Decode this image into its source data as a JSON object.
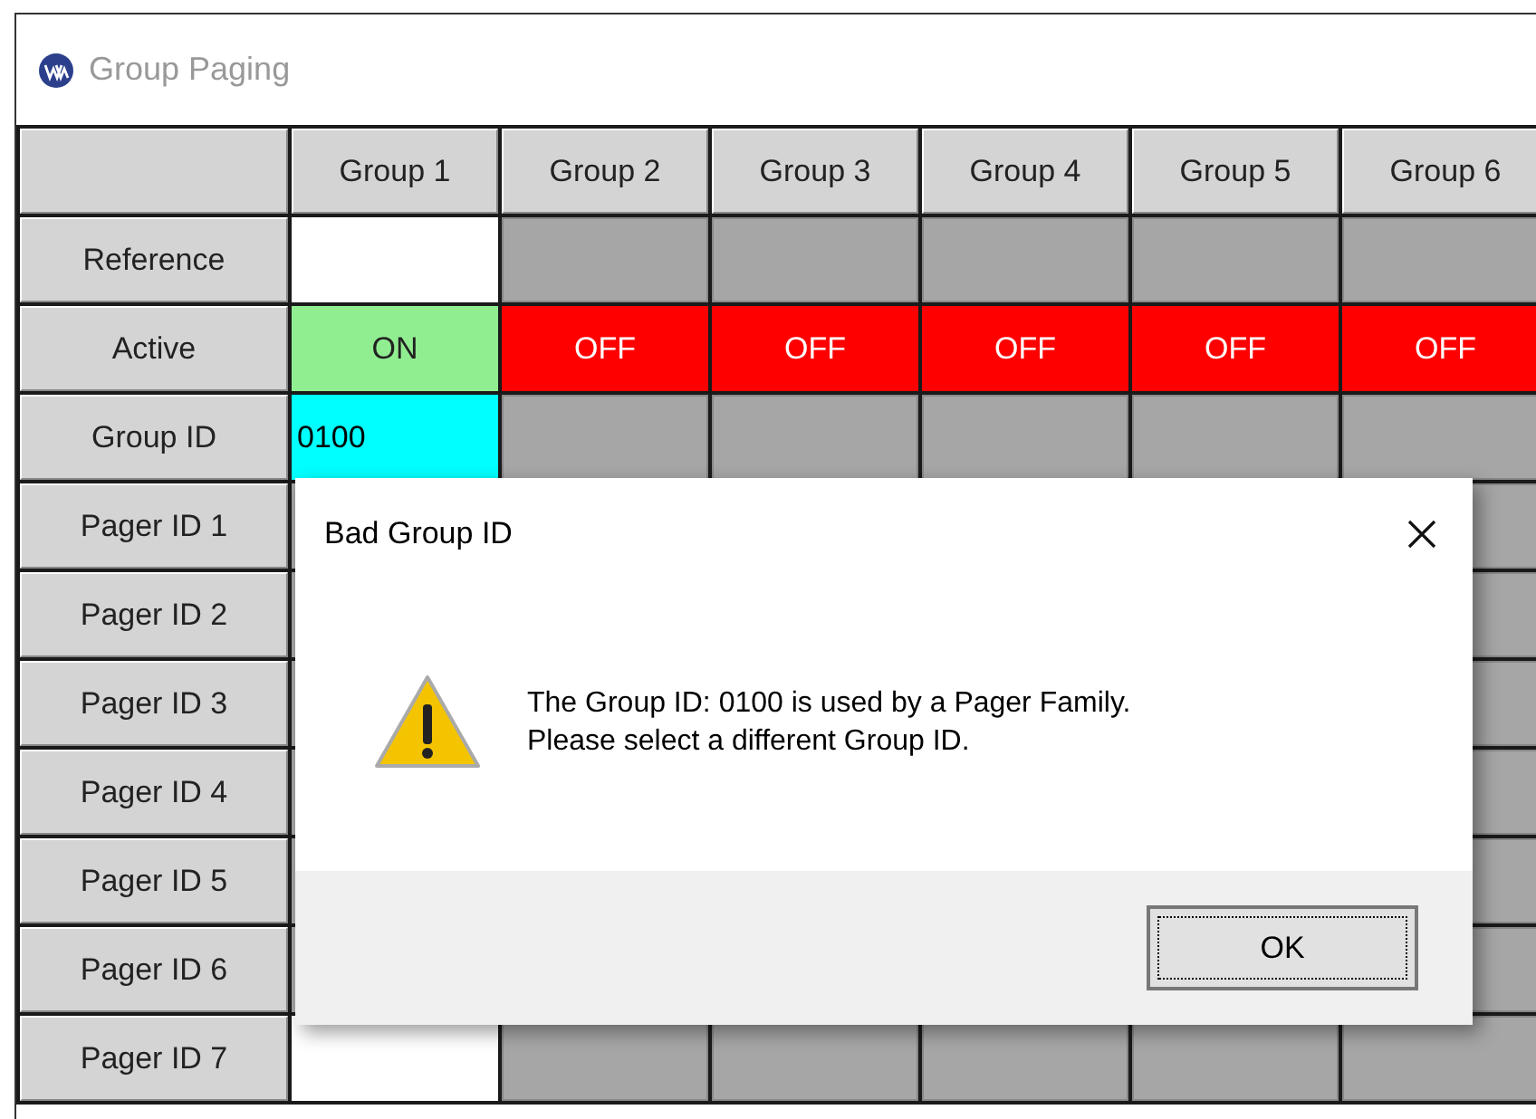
{
  "window": {
    "title": "Group Paging"
  },
  "columns": [
    "Group 1",
    "Group 2",
    "Group 3",
    "Group 4",
    "Group 5",
    "Group 6"
  ],
  "rows": [
    {
      "label": "Reference",
      "cells": [
        {
          "kind": "field",
          "enabled": true,
          "selected": false
        },
        {
          "kind": "field",
          "enabled": false,
          "selected": false
        },
        {
          "kind": "field",
          "enabled": false,
          "selected": false
        },
        {
          "kind": "field",
          "enabled": false,
          "selected": false
        },
        {
          "kind": "field",
          "enabled": false,
          "selected": false
        },
        {
          "kind": "field",
          "enabled": false,
          "selected": false
        }
      ]
    },
    {
      "label": "Active",
      "cells": [
        {
          "kind": "toggle",
          "on": true,
          "text": "ON"
        },
        {
          "kind": "toggle",
          "on": false,
          "text": "OFF"
        },
        {
          "kind": "toggle",
          "on": false,
          "text": "OFF"
        },
        {
          "kind": "toggle",
          "on": false,
          "text": "OFF"
        },
        {
          "kind": "toggle",
          "on": false,
          "text": "OFF"
        },
        {
          "kind": "toggle",
          "on": false,
          "text": "OFF"
        }
      ]
    },
    {
      "label": "Group ID",
      "cells": [
        {
          "kind": "field",
          "selected": true,
          "value": "0100"
        },
        {
          "kind": "field",
          "enabled": false,
          "selected": false
        },
        {
          "kind": "field",
          "enabled": false,
          "selected": false
        },
        {
          "kind": "field",
          "enabled": false,
          "selected": false
        },
        {
          "kind": "field",
          "enabled": false,
          "selected": false
        },
        {
          "kind": "field",
          "enabled": false,
          "selected": false
        }
      ]
    },
    {
      "label": "Pager ID 1",
      "cells": [
        null,
        null,
        null,
        null,
        null,
        {
          "kind": "field",
          "enabled": false,
          "selected": false
        }
      ]
    },
    {
      "label": "Pager ID 2",
      "cells": [
        null,
        null,
        null,
        null,
        null,
        {
          "kind": "field",
          "enabled": false,
          "selected": false
        }
      ]
    },
    {
      "label": "Pager ID 3",
      "cells": [
        null,
        null,
        null,
        null,
        null,
        {
          "kind": "field",
          "enabled": false,
          "selected": false
        }
      ]
    },
    {
      "label": "Pager ID 4",
      "cells": [
        null,
        null,
        null,
        null,
        null,
        {
          "kind": "field",
          "enabled": false,
          "selected": false
        }
      ]
    },
    {
      "label": "Pager ID 5",
      "cells": [
        null,
        null,
        null,
        null,
        null,
        {
          "kind": "field",
          "enabled": false,
          "selected": false
        }
      ]
    },
    {
      "label": "Pager ID 6",
      "cells": [
        null,
        null,
        null,
        null,
        null,
        {
          "kind": "field",
          "enabled": false,
          "selected": false
        }
      ]
    },
    {
      "label": "Pager ID 7",
      "cells": [
        {
          "kind": "field",
          "enabled": true,
          "selected": false
        },
        {
          "kind": "field",
          "enabled": false,
          "selected": false
        },
        {
          "kind": "field",
          "enabled": false,
          "selected": false
        },
        {
          "kind": "field",
          "enabled": false,
          "selected": false
        },
        {
          "kind": "field",
          "enabled": false,
          "selected": false
        },
        {
          "kind": "field",
          "enabled": false,
          "selected": false
        }
      ]
    }
  ],
  "dialog": {
    "title": "Bad Group ID",
    "message": [
      "The Group ID: 0100 is used by a Pager Family.",
      "Please select a different Group ID."
    ],
    "button": "OK"
  }
}
